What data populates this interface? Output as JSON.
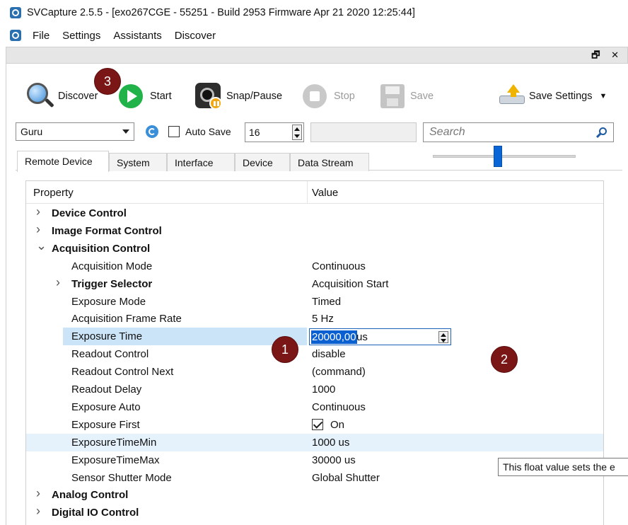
{
  "window": {
    "title": "SVCapture 2.5.5 - [exo267CGE - 55251 - Build 2953 Firmware Apr 21 2020 12:25:44]"
  },
  "menu": [
    "File",
    "Settings",
    "Assistants",
    "Discover"
  ],
  "panel": {
    "controls": "ᴮ ✕"
  },
  "toolbar": {
    "discover": "Discover",
    "start": "Start",
    "snap_pause": "Snap/Pause",
    "stop": "Stop",
    "save": "Save",
    "save_settings": "Save Settings"
  },
  "controls": {
    "camera_select": "Guru",
    "auto_save_label": "Auto Save",
    "auto_save_checked": false,
    "count_value": "16",
    "search_placeholder": "Search"
  },
  "tabs": [
    "Remote Device",
    "System",
    "Interface",
    "Device",
    "Data Stream"
  ],
  "active_tab": "Remote Device",
  "tree": {
    "header": {
      "property": "Property",
      "value": "Value"
    },
    "rows": [
      {
        "name": "Device Control",
        "value": "",
        "level": 0,
        "expander": "collapsed",
        "bold": true
      },
      {
        "name": "Image Format Control",
        "value": "",
        "level": 0,
        "expander": "collapsed",
        "bold": true
      },
      {
        "name": "Acquisition Control",
        "value": "",
        "level": 0,
        "expander": "expanded",
        "bold": true
      },
      {
        "name": "Acquisition Mode",
        "value": "Continuous",
        "level": 1
      },
      {
        "name": "Trigger Selector",
        "value": "Acquisition Start",
        "level": 1,
        "expander": "collapsed",
        "bold": true
      },
      {
        "name": "Exposure Mode",
        "value": "Timed",
        "level": 1
      },
      {
        "name": "Acquisition Frame Rate",
        "value": "5 Hz",
        "level": 1
      },
      {
        "name": "Exposure Time",
        "value": "",
        "level": 1,
        "editing": true,
        "selected": true
      },
      {
        "name": "Readout Control",
        "value": "disable",
        "level": 1
      },
      {
        "name": "Readout Control Next",
        "value": "(command)",
        "level": 1
      },
      {
        "name": "Readout Delay",
        "value": "1000",
        "level": 1
      },
      {
        "name": "Exposure Auto",
        "value": "Continuous",
        "level": 1
      },
      {
        "name": "Exposure First",
        "value": "On",
        "level": 1,
        "checkbox": true
      },
      {
        "name": "ExposureTimeMin",
        "value": "1000 us",
        "level": 1,
        "hover": true
      },
      {
        "name": "ExposureTimeMax",
        "value": "30000 us",
        "level": 1
      },
      {
        "name": "Sensor Shutter Mode",
        "value": "Global Shutter",
        "level": 1
      },
      {
        "name": "Analog Control",
        "value": "",
        "level": 0,
        "expander": "collapsed",
        "bold": true
      },
      {
        "name": "Digital IO Control",
        "value": "",
        "level": 0,
        "expander": "collapsed",
        "bold": true
      }
    ]
  },
  "exposure_edit": {
    "selected_text": "20000,00",
    "unit": "us"
  },
  "exposure_slider": {
    "fraction": 0.45
  },
  "tooltip": "This float value sets the e",
  "badges": [
    "1",
    "2",
    "3"
  ],
  "colors": {
    "selection": "#0a60d0",
    "badge": "#7a1616",
    "start_green": "#22b24a"
  }
}
